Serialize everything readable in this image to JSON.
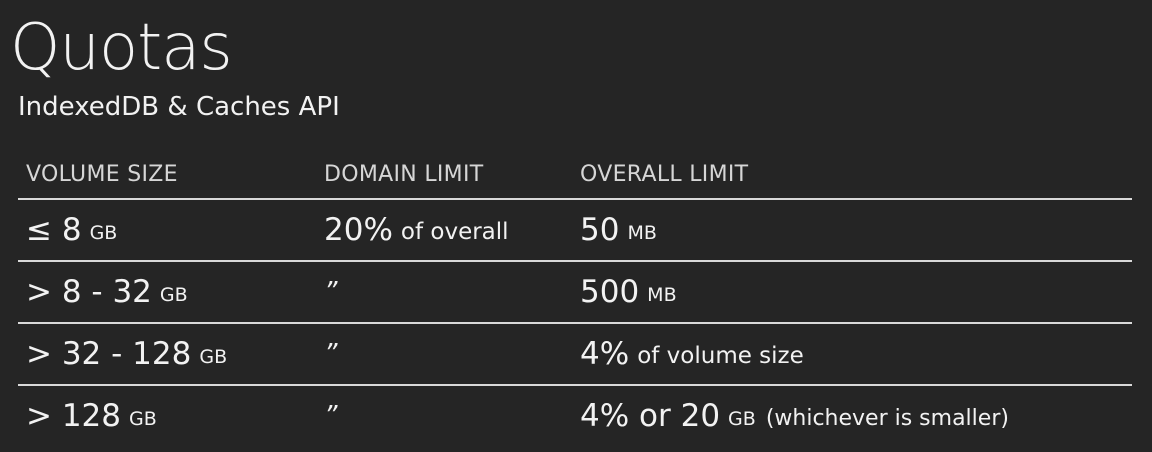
{
  "title": "Quotas",
  "subtitle": "IndexedDB & Caches API",
  "table": {
    "headers": [
      "VOLUME SIZE",
      "DOMAIN LIMIT",
      "OVERALL LIMIT"
    ],
    "rows": [
      {
        "volume": {
          "value": "≤ 8",
          "unit": "GB"
        },
        "domain": {
          "value": "20%",
          "suffix": "of overall"
        },
        "overall": {
          "value": "50",
          "unit": "MB"
        }
      },
      {
        "volume": {
          "value": "> 8 - 32",
          "unit": "GB"
        },
        "domain": {
          "value": "”"
        },
        "overall": {
          "value": "500",
          "unit": "MB"
        }
      },
      {
        "volume": {
          "value": "> 32 - 128",
          "unit": "GB"
        },
        "domain": {
          "value": "”"
        },
        "overall": {
          "value": "4%",
          "suffix": "of volume size"
        }
      },
      {
        "volume": {
          "value": "> 128",
          "unit": "GB"
        },
        "domain": {
          "value": "”"
        },
        "overall": {
          "value": "4% or 20",
          "unit": "GB",
          "note": "(whichever is smaller)"
        }
      }
    ]
  }
}
